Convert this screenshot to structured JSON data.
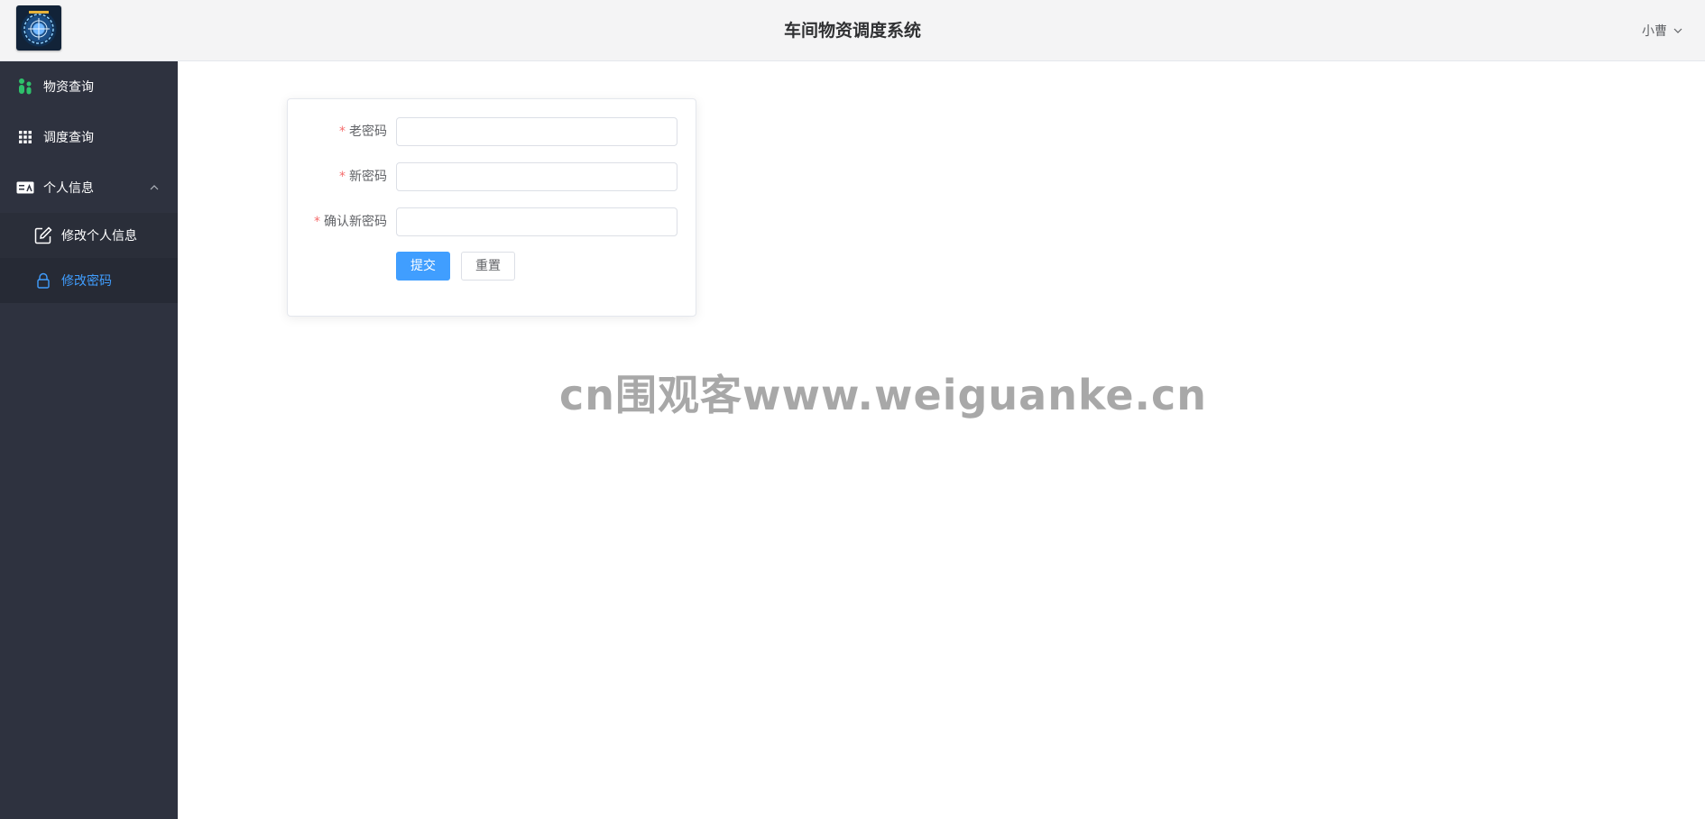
{
  "header": {
    "title": "车间物资调度系统",
    "user_name": "小曹",
    "logo_icon": "logo-icon",
    "dropdown_icon": "chevron-down-icon"
  },
  "sidebar": {
    "items": [
      {
        "label": "物资查询",
        "icon": "people-icon"
      },
      {
        "label": "调度查询",
        "icon": "grid-icon"
      },
      {
        "label": "个人信息",
        "icon": "id-card-icon",
        "expanded": true,
        "children": [
          {
            "label": "修改个人信息",
            "icon": "edit-icon"
          },
          {
            "label": "修改密码",
            "icon": "lock-icon",
            "active": true
          }
        ]
      }
    ]
  },
  "form": {
    "required_mark": "*",
    "fields": [
      {
        "label": "老密码",
        "value": ""
      },
      {
        "label": "新密码",
        "value": ""
      },
      {
        "label": "确认新密码",
        "value": ""
      }
    ],
    "submit_label": "提交",
    "reset_label": "重置"
  },
  "watermark": "cn围观客www.weiguanke.cn",
  "colors": {
    "sidebar_bg": "#2e323f",
    "accent": "#409eff",
    "required": "#f56c6c",
    "header_bg": "#f4f4f5",
    "menu_icon_green": "#2ec16b"
  }
}
